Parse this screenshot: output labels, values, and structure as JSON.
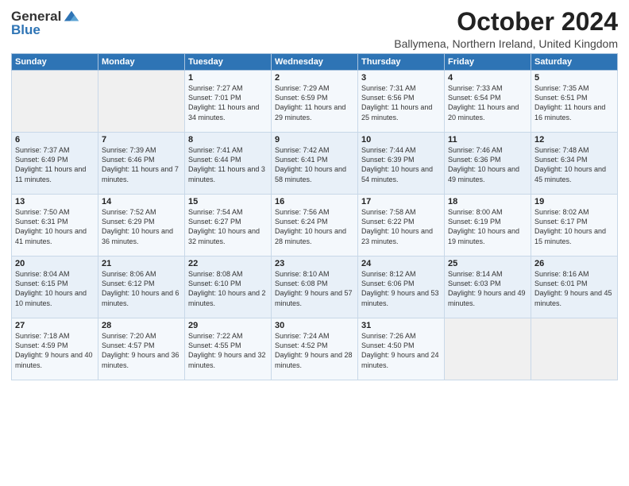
{
  "logo": {
    "general": "General",
    "blue": "Blue"
  },
  "title": "October 2024",
  "subtitle": "Ballymena, Northern Ireland, United Kingdom",
  "days_of_week": [
    "Sunday",
    "Monday",
    "Tuesday",
    "Wednesday",
    "Thursday",
    "Friday",
    "Saturday"
  ],
  "weeks": [
    [
      {
        "day": "",
        "sunrise": "",
        "sunset": "",
        "daylight": ""
      },
      {
        "day": "",
        "sunrise": "",
        "sunset": "",
        "daylight": ""
      },
      {
        "day": "1",
        "sunrise": "Sunrise: 7:27 AM",
        "sunset": "Sunset: 7:01 PM",
        "daylight": "Daylight: 11 hours and 34 minutes."
      },
      {
        "day": "2",
        "sunrise": "Sunrise: 7:29 AM",
        "sunset": "Sunset: 6:59 PM",
        "daylight": "Daylight: 11 hours and 29 minutes."
      },
      {
        "day": "3",
        "sunrise": "Sunrise: 7:31 AM",
        "sunset": "Sunset: 6:56 PM",
        "daylight": "Daylight: 11 hours and 25 minutes."
      },
      {
        "day": "4",
        "sunrise": "Sunrise: 7:33 AM",
        "sunset": "Sunset: 6:54 PM",
        "daylight": "Daylight: 11 hours and 20 minutes."
      },
      {
        "day": "5",
        "sunrise": "Sunrise: 7:35 AM",
        "sunset": "Sunset: 6:51 PM",
        "daylight": "Daylight: 11 hours and 16 minutes."
      }
    ],
    [
      {
        "day": "6",
        "sunrise": "Sunrise: 7:37 AM",
        "sunset": "Sunset: 6:49 PM",
        "daylight": "Daylight: 11 hours and 11 minutes."
      },
      {
        "day": "7",
        "sunrise": "Sunrise: 7:39 AM",
        "sunset": "Sunset: 6:46 PM",
        "daylight": "Daylight: 11 hours and 7 minutes."
      },
      {
        "day": "8",
        "sunrise": "Sunrise: 7:41 AM",
        "sunset": "Sunset: 6:44 PM",
        "daylight": "Daylight: 11 hours and 3 minutes."
      },
      {
        "day": "9",
        "sunrise": "Sunrise: 7:42 AM",
        "sunset": "Sunset: 6:41 PM",
        "daylight": "Daylight: 10 hours and 58 minutes."
      },
      {
        "day": "10",
        "sunrise": "Sunrise: 7:44 AM",
        "sunset": "Sunset: 6:39 PM",
        "daylight": "Daylight: 10 hours and 54 minutes."
      },
      {
        "day": "11",
        "sunrise": "Sunrise: 7:46 AM",
        "sunset": "Sunset: 6:36 PM",
        "daylight": "Daylight: 10 hours and 49 minutes."
      },
      {
        "day": "12",
        "sunrise": "Sunrise: 7:48 AM",
        "sunset": "Sunset: 6:34 PM",
        "daylight": "Daylight: 10 hours and 45 minutes."
      }
    ],
    [
      {
        "day": "13",
        "sunrise": "Sunrise: 7:50 AM",
        "sunset": "Sunset: 6:31 PM",
        "daylight": "Daylight: 10 hours and 41 minutes."
      },
      {
        "day": "14",
        "sunrise": "Sunrise: 7:52 AM",
        "sunset": "Sunset: 6:29 PM",
        "daylight": "Daylight: 10 hours and 36 minutes."
      },
      {
        "day": "15",
        "sunrise": "Sunrise: 7:54 AM",
        "sunset": "Sunset: 6:27 PM",
        "daylight": "Daylight: 10 hours and 32 minutes."
      },
      {
        "day": "16",
        "sunrise": "Sunrise: 7:56 AM",
        "sunset": "Sunset: 6:24 PM",
        "daylight": "Daylight: 10 hours and 28 minutes."
      },
      {
        "day": "17",
        "sunrise": "Sunrise: 7:58 AM",
        "sunset": "Sunset: 6:22 PM",
        "daylight": "Daylight: 10 hours and 23 minutes."
      },
      {
        "day": "18",
        "sunrise": "Sunrise: 8:00 AM",
        "sunset": "Sunset: 6:19 PM",
        "daylight": "Daylight: 10 hours and 19 minutes."
      },
      {
        "day": "19",
        "sunrise": "Sunrise: 8:02 AM",
        "sunset": "Sunset: 6:17 PM",
        "daylight": "Daylight: 10 hours and 15 minutes."
      }
    ],
    [
      {
        "day": "20",
        "sunrise": "Sunrise: 8:04 AM",
        "sunset": "Sunset: 6:15 PM",
        "daylight": "Daylight: 10 hours and 10 minutes."
      },
      {
        "day": "21",
        "sunrise": "Sunrise: 8:06 AM",
        "sunset": "Sunset: 6:12 PM",
        "daylight": "Daylight: 10 hours and 6 minutes."
      },
      {
        "day": "22",
        "sunrise": "Sunrise: 8:08 AM",
        "sunset": "Sunset: 6:10 PM",
        "daylight": "Daylight: 10 hours and 2 minutes."
      },
      {
        "day": "23",
        "sunrise": "Sunrise: 8:10 AM",
        "sunset": "Sunset: 6:08 PM",
        "daylight": "Daylight: 9 hours and 57 minutes."
      },
      {
        "day": "24",
        "sunrise": "Sunrise: 8:12 AM",
        "sunset": "Sunset: 6:06 PM",
        "daylight": "Daylight: 9 hours and 53 minutes."
      },
      {
        "day": "25",
        "sunrise": "Sunrise: 8:14 AM",
        "sunset": "Sunset: 6:03 PM",
        "daylight": "Daylight: 9 hours and 49 minutes."
      },
      {
        "day": "26",
        "sunrise": "Sunrise: 8:16 AM",
        "sunset": "Sunset: 6:01 PM",
        "daylight": "Daylight: 9 hours and 45 minutes."
      }
    ],
    [
      {
        "day": "27",
        "sunrise": "Sunrise: 7:18 AM",
        "sunset": "Sunset: 4:59 PM",
        "daylight": "Daylight: 9 hours and 40 minutes."
      },
      {
        "day": "28",
        "sunrise": "Sunrise: 7:20 AM",
        "sunset": "Sunset: 4:57 PM",
        "daylight": "Daylight: 9 hours and 36 minutes."
      },
      {
        "day": "29",
        "sunrise": "Sunrise: 7:22 AM",
        "sunset": "Sunset: 4:55 PM",
        "daylight": "Daylight: 9 hours and 32 minutes."
      },
      {
        "day": "30",
        "sunrise": "Sunrise: 7:24 AM",
        "sunset": "Sunset: 4:52 PM",
        "daylight": "Daylight: 9 hours and 28 minutes."
      },
      {
        "day": "31",
        "sunrise": "Sunrise: 7:26 AM",
        "sunset": "Sunset: 4:50 PM",
        "daylight": "Daylight: 9 hours and 24 minutes."
      },
      {
        "day": "",
        "sunrise": "",
        "sunset": "",
        "daylight": ""
      },
      {
        "day": "",
        "sunrise": "",
        "sunset": "",
        "daylight": ""
      }
    ]
  ]
}
